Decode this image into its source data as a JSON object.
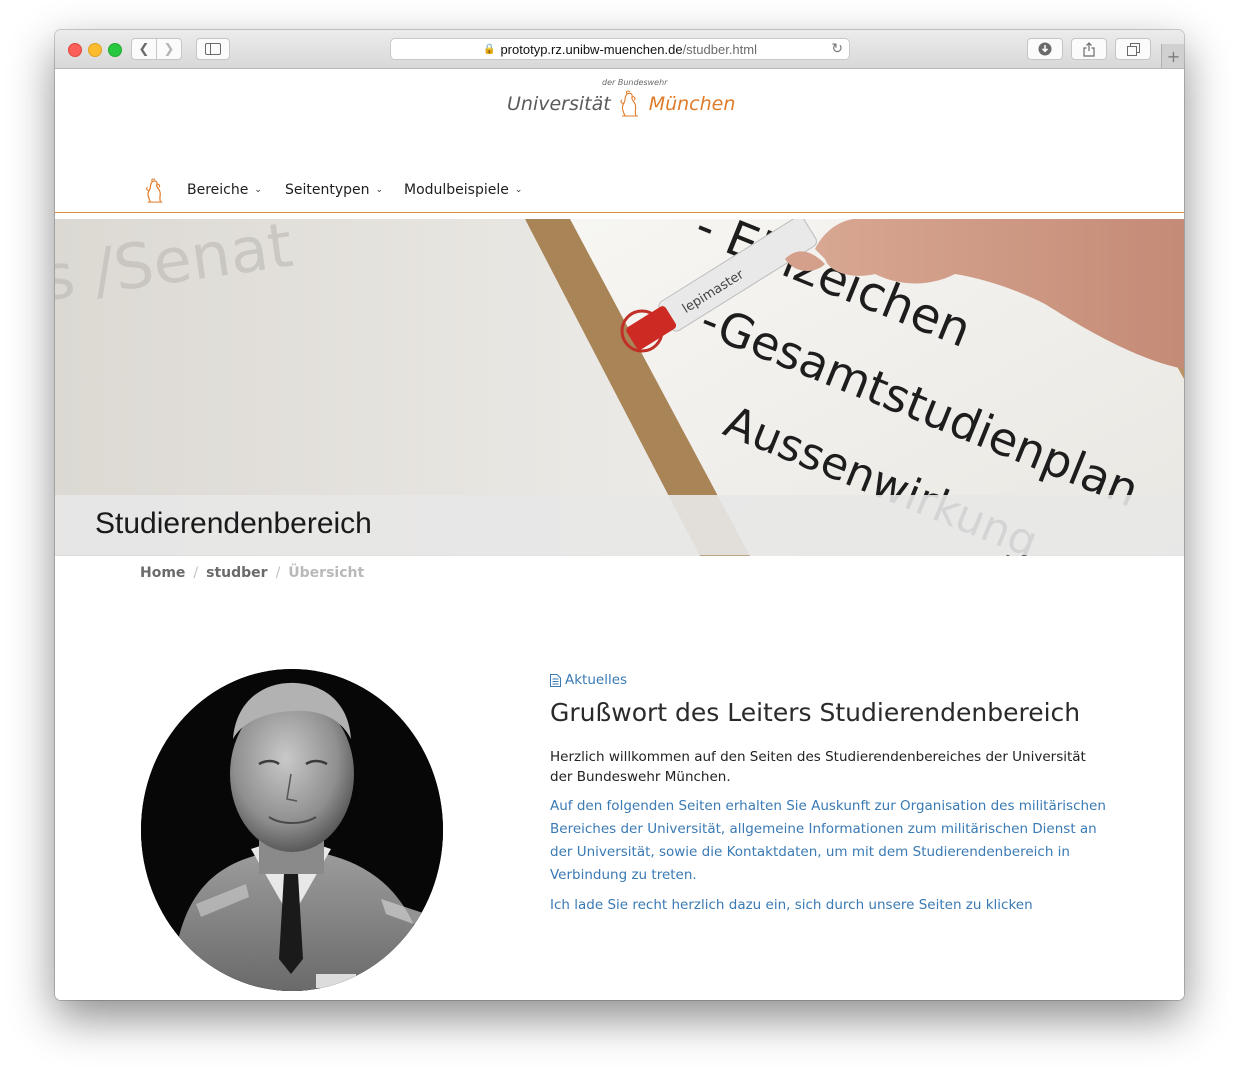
{
  "browser": {
    "url_domain": "prototyp.rz.unibw-muenchen.de",
    "url_path": "/studber.html"
  },
  "logo": {
    "small_text": "der Bundeswehr",
    "left_text": "Universität",
    "right_text": "München"
  },
  "nav": {
    "items": [
      {
        "label": "Bereiche"
      },
      {
        "label": "Seitentypen"
      },
      {
        "label": "Modulbeispiele"
      }
    ]
  },
  "hero": {
    "title": "Studierendenbereich",
    "marker_brand": "lepimaster",
    "board_text": [
      "s /Senat",
      "- Einzeichen",
      "-Gesamtstudienplan",
      "Aussenwirkung"
    ]
  },
  "breadcrumb": {
    "items": [
      "Home",
      "studber",
      "Übersicht"
    ]
  },
  "article": {
    "category": "Aktuelles",
    "headline": "Grußwort des Leiters Studierendenbereich",
    "intro": "Herzlich willkommen auf den Seiten des Studierendenbereiches der Universität der Bundeswehr München.",
    "body": "Auf den folgenden Seiten erhalten Sie Auskunft zur Organisation des militärischen Bereiches der Universität, allgemeine Informationen zum militärischen Dienst an der Universität, sowie die Kontaktdaten, um mit dem Studierendenbereich in Verbindung zu treten.",
    "closing": "Ich lade Sie recht herzlich dazu ein, sich durch unsere Seiten zu klicken"
  },
  "colors": {
    "accent_orange": "#e07b29",
    "link_blue": "#3a7ab5"
  }
}
